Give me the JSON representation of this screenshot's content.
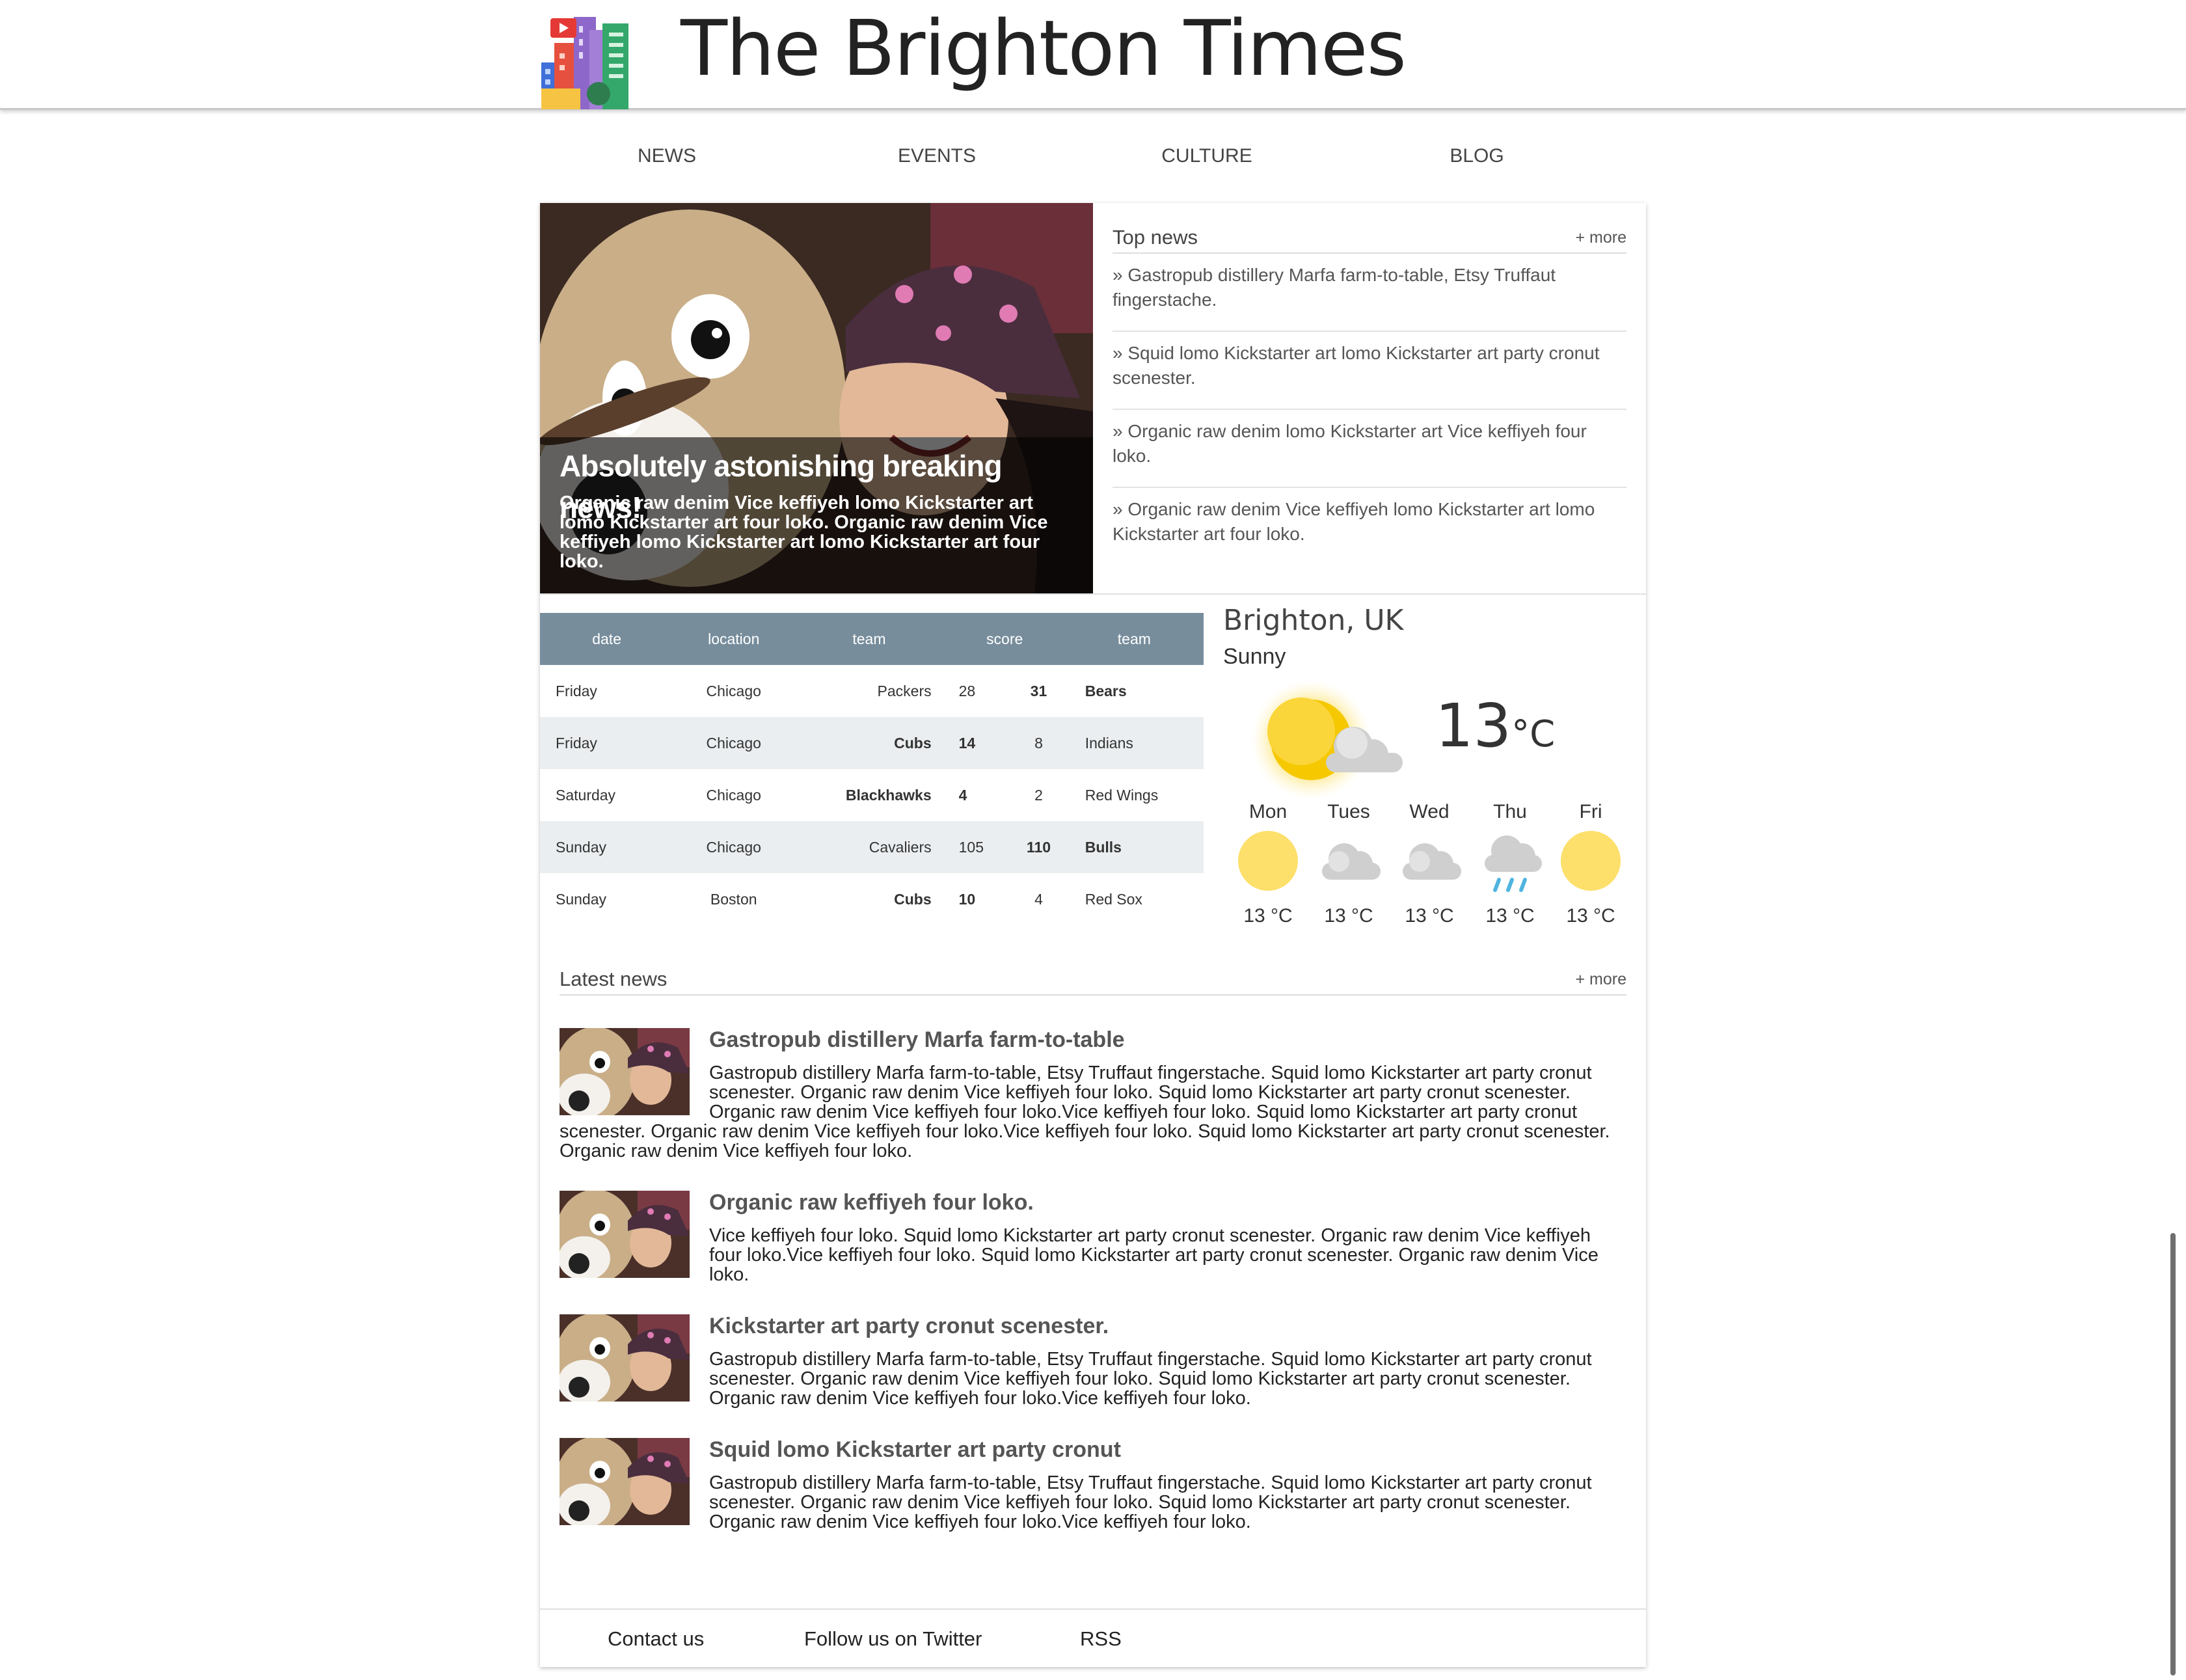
{
  "header": {
    "title": "The Brighton Times",
    "logo_icon": "city-buildings-icon"
  },
  "nav": [
    {
      "label": "NEWS"
    },
    {
      "label": "EVENTS"
    },
    {
      "label": "CULTURE"
    },
    {
      "label": "BLOG"
    }
  ],
  "hero": {
    "title": "Absolutely astonishing breaking news!",
    "text": "Organic raw denim Vice keffiyeh lomo Kickstarter art lomo Kickstarter art four loko. Organic raw denim Vice keffiyeh lomo Kickstarter art lomo Kickstarter art four loko."
  },
  "top_news": {
    "title": "Top news",
    "more": "+ more",
    "items": [
      "» Gastropub distillery Marfa farm-to-table, Etsy Truffaut fingerstache.",
      "» Squid lomo Kickstarter art lomo Kickstarter art party cronut scenester.",
      "» Organic raw denim lomo Kickstarter art Vice keffiyeh four loko.",
      "» Organic raw denim Vice keffiyeh lomo Kickstarter art lomo Kickstarter art four loko."
    ]
  },
  "scores": {
    "headers": [
      "date",
      "location",
      "team",
      "score",
      "team"
    ],
    "rows": [
      {
        "date": "Friday",
        "location": "Chicago",
        "team1": "Packers",
        "score1": "28",
        "score2": "31",
        "team2": "Bears",
        "winner": 2
      },
      {
        "date": "Friday",
        "location": "Chicago",
        "team1": "Cubs",
        "score1": "14",
        "score2": "8",
        "team2": "Indians",
        "winner": 1
      },
      {
        "date": "Saturday",
        "location": "Chicago",
        "team1": "Blackhawks",
        "score1": "4",
        "score2": "2",
        "team2": "Red Wings",
        "winner": 1
      },
      {
        "date": "Sunday",
        "location": "Chicago",
        "team1": "Cavaliers",
        "score1": "105",
        "score2": "110",
        "team2": "Bulls",
        "winner": 2
      },
      {
        "date": "Sunday",
        "location": "Boston",
        "team1": "Cubs",
        "score1": "10",
        "score2": "4",
        "team2": "Red Sox",
        "winner": 1
      }
    ]
  },
  "weather": {
    "location": "Brighton, UK",
    "condition": "Sunny",
    "temp": "13",
    "unit": "°C",
    "current_icon": "sun-behind-cloud-icon",
    "forecast": [
      {
        "day": "Mon",
        "temp": "13 °C",
        "icon": "sun-icon"
      },
      {
        "day": "Tues",
        "temp": "13 °C",
        "icon": "cloud-icon"
      },
      {
        "day": "Wed",
        "temp": "13 °C",
        "icon": "cloud-icon"
      },
      {
        "day": "Thu",
        "temp": "13 °C",
        "icon": "rain-cloud-icon"
      },
      {
        "day": "Fri",
        "temp": "13 °C",
        "icon": "sun-icon"
      }
    ]
  },
  "latest_news": {
    "title": "Latest news",
    "more": "+ more",
    "items": [
      {
        "title": "Gastropub distillery Marfa farm-to-table",
        "text": "Gastropub distillery Marfa farm-to-table, Etsy Truffaut fingerstache. Squid lomo Kickstarter art party cronut scenester. Organic raw denim Vice keffiyeh four loko. Squid lomo Kickstarter art party cronut scenester. Organic raw denim Vice keffiyeh four loko.Vice keffiyeh four loko. Squid lomo Kickstarter art party cronut scenester. Organic raw denim Vice keffiyeh four loko.Vice keffiyeh four loko. Squid lomo Kickstarter art party cronut scenester. Organic raw denim Vice keffiyeh four loko."
      },
      {
        "title": "Organic raw keffiyeh four loko.",
        "text": "Vice keffiyeh four loko. Squid lomo Kickstarter art party cronut scenester. Organic raw denim Vice keffiyeh four loko.Vice keffiyeh four loko. Squid lomo Kickstarter art party cronut scenester. Organic raw denim Vice loko."
      },
      {
        "title": "Kickstarter art party cronut scenester.",
        "text": "Gastropub distillery Marfa farm-to-table, Etsy Truffaut fingerstache. Squid lomo Kickstarter art party cronut scenester. Organic raw denim Vice keffiyeh four loko. Squid lomo Kickstarter art party cronut scenester. Organic raw denim Vice keffiyeh four loko.Vice keffiyeh four loko."
      },
      {
        "title": "Squid lomo Kickstarter art party cronut",
        "text": "Gastropub distillery Marfa farm-to-table, Etsy Truffaut fingerstache. Squid lomo Kickstarter art party cronut scenester. Organic raw denim Vice keffiyeh four loko. Squid lomo Kickstarter art party cronut scenester. Organic raw denim Vice keffiyeh four loko.Vice keffiyeh four loko."
      }
    ]
  },
  "footer": {
    "links": [
      "Contact us",
      "Follow us on Twitter",
      "RSS"
    ]
  },
  "colors": {
    "table_header": "#778d9c",
    "table_alt_row": "#ebeef0",
    "sun": "#fde06b",
    "cloud": "#cfcfcf",
    "rain": "#4fb4e0"
  }
}
